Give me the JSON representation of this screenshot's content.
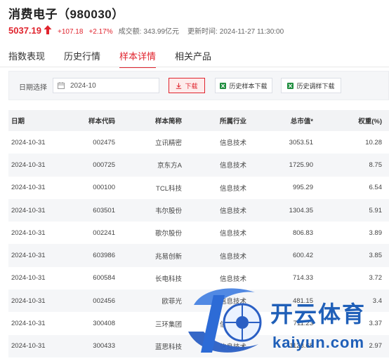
{
  "header": {
    "title": "消费电子（980030）",
    "price": "5037.19",
    "change": "+107.18",
    "change_pct": "+2.17%",
    "volume_label": "成交额:",
    "volume_value": "343.99亿元",
    "time_label": "更新时间:",
    "time_value": "2024-11-27 11:30:00",
    "up_color": "#e0242e"
  },
  "tabs": [
    "指数表现",
    "历史行情",
    "样本详情",
    "相关产品"
  ],
  "active_tab": "样本详情",
  "filter": {
    "label": "日期选择",
    "date_value": "2024-10",
    "download_label": "下载",
    "sample_download_label": "历史样本下载",
    "adjust_download_label": "历史调样下载"
  },
  "table": {
    "columns": [
      "日期",
      "样本代码",
      "样本简称",
      "所属行业",
      "总市值*",
      "权重(%)"
    ],
    "rows": [
      [
        "2024-10-31",
        "002475",
        "立讯精密",
        "信息技术",
        "3053.51",
        "10.28"
      ],
      [
        "2024-10-31",
        "000725",
        "京东方A",
        "信息技术",
        "1725.90",
        "8.75"
      ],
      [
        "2024-10-31",
        "000100",
        "TCL科技",
        "信息技术",
        "995.29",
        "6.54"
      ],
      [
        "2024-10-31",
        "603501",
        "韦尔股份",
        "信息技术",
        "1304.35",
        "5.91"
      ],
      [
        "2024-10-31",
        "002241",
        "歌尔股份",
        "信息技术",
        "806.83",
        "3.89"
      ],
      [
        "2024-10-31",
        "603986",
        "兆易创新",
        "信息技术",
        "600.42",
        "3.85"
      ],
      [
        "2024-10-31",
        "600584",
        "长电科技",
        "信息技术",
        "714.33",
        "3.72"
      ],
      [
        "2024-10-31",
        "002456",
        "欧菲光",
        "信息技术",
        "481.15",
        "3.4"
      ],
      [
        "2024-10-31",
        "300408",
        "三环集团",
        "信息技术",
        "711.23",
        "3.37"
      ],
      [
        "2024-10-31",
        "300433",
        "蓝思科技",
        "信息技术",
        "1123.68",
        "2.97"
      ]
    ]
  },
  "watermark": {
    "brand": "开云体育",
    "url": "kaiyun.com",
    "color": "#1f5fb8"
  }
}
